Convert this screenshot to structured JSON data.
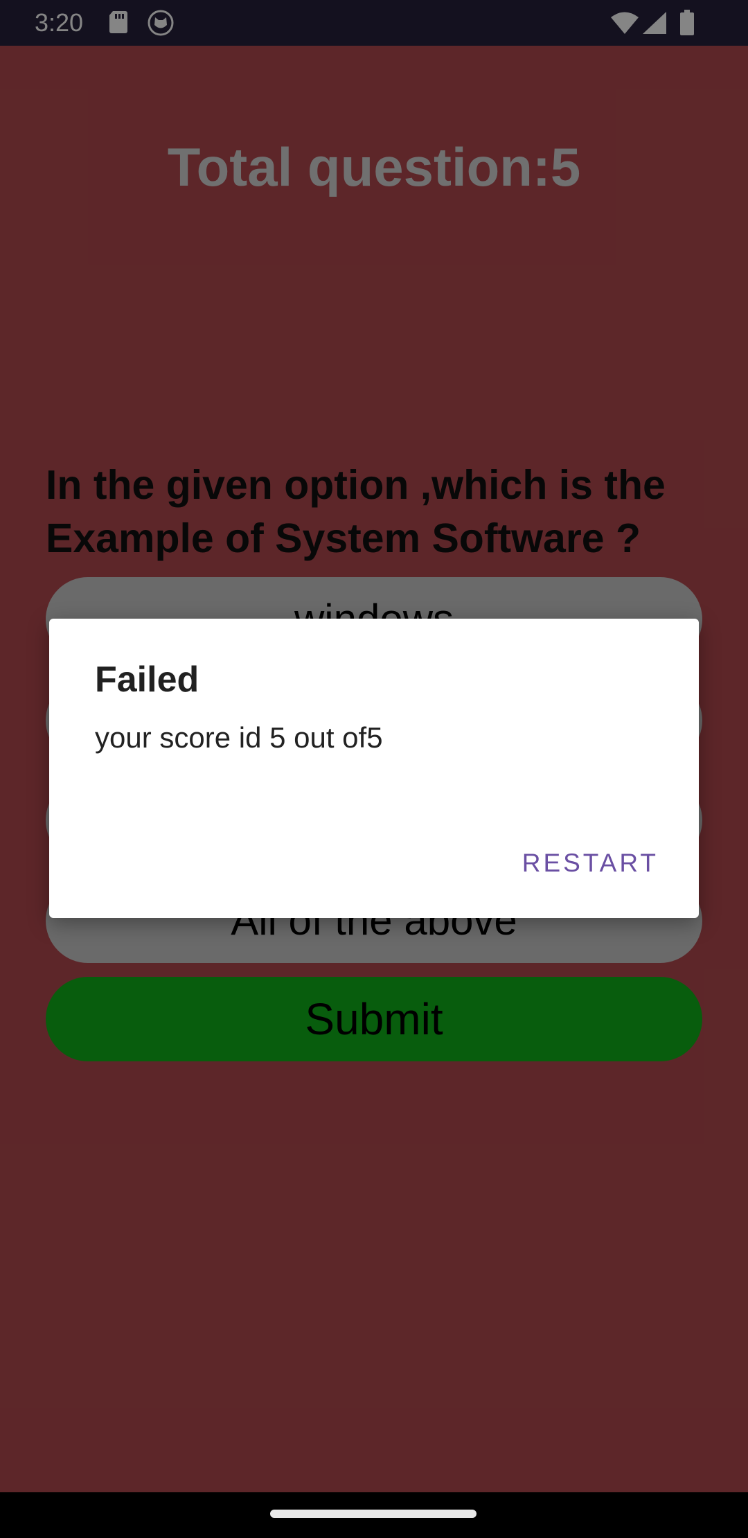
{
  "status_bar": {
    "time": "3:20",
    "icons": [
      "sd-card-icon",
      "cat-icon",
      "wifi-icon",
      "signal-icon",
      "battery-icon"
    ]
  },
  "quiz": {
    "total_label": "Total question:5",
    "question": "In the given option ,which is the Example of System Software ?",
    "options": [
      "windows",
      "",
      "",
      "All of the above"
    ],
    "submit_label": "Submit"
  },
  "dialog": {
    "title": "Failed",
    "message": "your score id 5 out of5",
    "action_label": "RESTART"
  },
  "colors": {
    "background": "#5e2124",
    "status_bar": "#27213d",
    "submit": "#10b21a",
    "dialog_action": "#6a4fa3"
  }
}
